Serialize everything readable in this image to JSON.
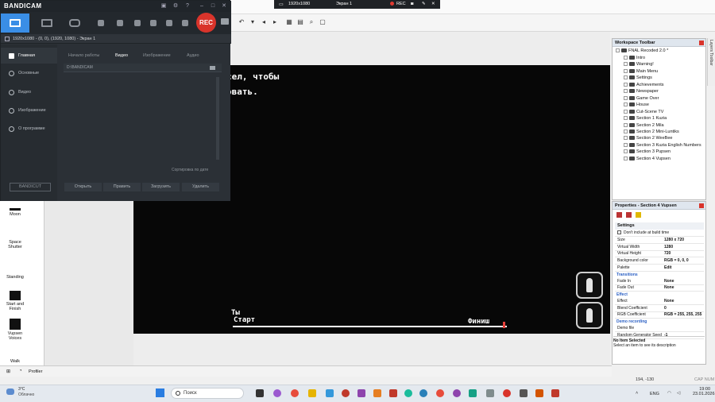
{
  "bandicam": {
    "logo": "BANDICAM",
    "rec_label": "REC",
    "source_line": "1920x1080 - (0, 0), (1920, 1080) - Экран 1",
    "sidebar": [
      {
        "label": "Главная"
      },
      {
        "label": "Основные"
      },
      {
        "label": "Видео"
      },
      {
        "label": "Изображение"
      },
      {
        "label": "О программе"
      }
    ],
    "tabs": [
      {
        "label": "Начало работы"
      },
      {
        "label": "Видео"
      },
      {
        "label": "Изображение"
      },
      {
        "label": "Аудио"
      }
    ],
    "folder_path": "D:\\BANDICAM",
    "sort_label": "Сортировка по дате",
    "actions": [
      {
        "label": "Открыть"
      },
      {
        "label": "Править"
      },
      {
        "label": "Загрузить"
      },
      {
        "label": "Удалить"
      }
    ],
    "bandicut": "BANDICUT"
  },
  "recbar": {
    "resolution": "1920x1080",
    "screen": "Экран 1",
    "rec_label": "REC"
  },
  "game": {
    "text_line1": "сел, чтобы",
    "text_line2": "овать.",
    "start_label_prefix": "Ты",
    "start_label": "Старт",
    "finish_label": "Финиш",
    "progress_fraction": 1.0
  },
  "objects": [
    {
      "label": "Moon"
    },
    {
      "label": "Space Shutter"
    },
    {
      "label": "Standing"
    },
    {
      "label": "Start and Finish"
    },
    {
      "label": "Vupsen Voices"
    },
    {
      "label": "Walk"
    }
  ],
  "status": {
    "profiler": "Profiler",
    "coords": "194, -130",
    "caps": "CAP NUM"
  },
  "workspace": {
    "title": "Workspace Toolbar",
    "side_tab": "Layers Toolbar",
    "root": "FNAL Recoded 2.0 *",
    "items": [
      {
        "label": "Intro"
      },
      {
        "label": "Warning!"
      },
      {
        "label": "Main Menu"
      },
      {
        "label": "Settings"
      },
      {
        "label": "Achievements"
      },
      {
        "label": "Newspaper"
      },
      {
        "label": "Game Over"
      },
      {
        "label": "House"
      },
      {
        "label": "Cut-Scene TV"
      },
      {
        "label": "Section 1 Kuzia"
      },
      {
        "label": "Section 2 Mila"
      },
      {
        "label": "Section 2 Mini-Luntiks"
      },
      {
        "label": "Section 2 WeeBee"
      },
      {
        "label": "Section 3 Kuzia English Numbers"
      },
      {
        "label": "Section 3 Pupsen"
      },
      {
        "label": "Section 4 Vupsen"
      }
    ]
  },
  "properties": {
    "title": "Properties - Section 4 Vupsen",
    "settings_header": "Settings",
    "dont_include": "Don't include at build time",
    "rows_main": [
      {
        "key": "Size",
        "value": "1280 x 720"
      },
      {
        "key": "Virtual Width",
        "value": "1280"
      },
      {
        "key": "Virtual Height",
        "value": "720"
      },
      {
        "key": "Background color",
        "value": "RGB = 0, 0, 0"
      },
      {
        "key": "Palette",
        "value": "Edit"
      }
    ],
    "transitions_header": "Transitions",
    "rows_transitions": [
      {
        "key": "Fade In",
        "value": "None"
      },
      {
        "key": "Fade Out",
        "value": "None"
      }
    ],
    "effect_header": "Effect",
    "rows_effect": [
      {
        "key": "Effect",
        "value": "None"
      },
      {
        "key": "Blend Coefficient",
        "value": "0"
      },
      {
        "key": "RGB Coefficient",
        "value": "RGB = 255, 255, 255"
      }
    ],
    "demo_header": "Demo recording",
    "rows_demo": [
      {
        "key": "Demo file",
        "value": ""
      },
      {
        "key": "Random Generator Seed",
        "value": "-1"
      }
    ],
    "footer_title": "No Item Selected",
    "footer_text": "Select an item to see its description"
  },
  "taskbar": {
    "weather_temp": "3°C",
    "weather_desc": "Облачно",
    "search_placeholder": "Поиск",
    "lang": "ENG",
    "time": "19:00",
    "date": "23.01.2026"
  },
  "colors": {
    "rec_red": "#d9342b",
    "bandicam_accent": "#3a8ee6",
    "canvas_bg": "#070707"
  }
}
